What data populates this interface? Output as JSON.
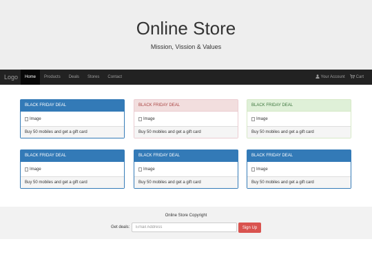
{
  "header": {
    "title": "Online Store",
    "subtitle": "Mission, Vission & Values"
  },
  "navbar": {
    "brand": "Logo",
    "items": [
      {
        "label": "Home",
        "active": true
      },
      {
        "label": "Products"
      },
      {
        "label": "Deals"
      },
      {
        "label": "Stores"
      },
      {
        "label": "Contact"
      }
    ],
    "right_items": [
      {
        "label": "Your Account",
        "icon": "user-icon"
      },
      {
        "label": "Cart",
        "icon": "cart-icon"
      }
    ]
  },
  "panels": [
    {
      "heading": "BLACK FRIDAY DEAL",
      "image_alt": "Image",
      "footer": "Buy 50 mobiles and get a gift card",
      "style": "primary"
    },
    {
      "heading": "BLACK FRIDAY DEAL",
      "image_alt": "Image",
      "footer": "Buy 50 mobiles and get a gift card",
      "style": "danger"
    },
    {
      "heading": "BLACK FRIDAY DEAL",
      "image_alt": "Image",
      "footer": "Buy 50 mobiles and get a gift card",
      "style": "success"
    },
    {
      "heading": "BLACK FRIDAY DEAL",
      "image_alt": "Image",
      "footer": "Buy 50 mobiles and get a gift card",
      "style": "primary"
    },
    {
      "heading": "BLACK FRIDAY DEAL",
      "image_alt": "Image",
      "footer": "Buy 50 mobiles and get a gift card",
      "style": "primary"
    },
    {
      "heading": "BLACK FRIDAY DEAL",
      "image_alt": "Image",
      "footer": "Buy 50 mobiles and get a gift card",
      "style": "primary"
    }
  ],
  "footer": {
    "copyright": "Online Store Copyright",
    "deals_label": "Get deals:",
    "email_placeholder": "Email Address",
    "signup_label": "Sign Up"
  },
  "colors": {
    "primary": "#337ab7",
    "danger_bg": "#f2dede",
    "success_bg": "#dff0d8",
    "signup_button": "#d9534f",
    "navbar": "#222222"
  }
}
